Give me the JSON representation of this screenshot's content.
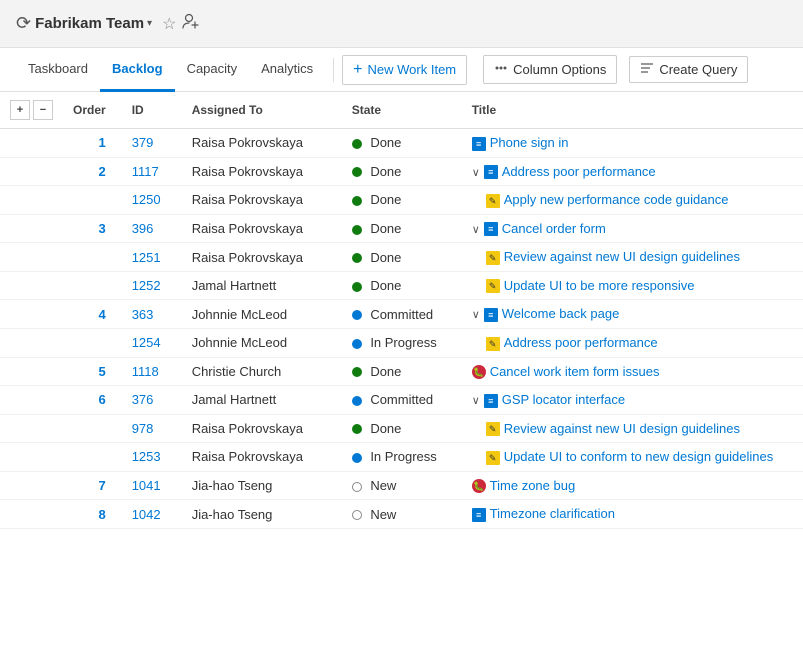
{
  "topbar": {
    "team_name": "Fabrikam Team",
    "team_icon": "🔄",
    "chevron": "▾",
    "star": "☆",
    "person": "👤"
  },
  "nav": {
    "tabs": [
      {
        "id": "taskboard",
        "label": "Taskboard",
        "active": false
      },
      {
        "id": "backlog",
        "label": "Backlog",
        "active": true
      },
      {
        "id": "capacity",
        "label": "Capacity",
        "active": false
      },
      {
        "id": "analytics",
        "label": "Analytics",
        "active": false
      }
    ]
  },
  "toolbar": {
    "new_work_item": "New Work Item",
    "column_options": "Column Options",
    "create_query": "Create Query",
    "new_icon": "+",
    "col_icon": "🖊",
    "query_icon": "≡"
  },
  "table": {
    "headers": [
      "",
      "Order",
      "ID",
      "Assigned To",
      "State",
      "Title"
    ],
    "rows": [
      {
        "order": "1",
        "id": "379",
        "assigned": "Raisa Pokrovskaya",
        "state": "Done",
        "state_type": "done",
        "title": "Phone sign in",
        "item_type": "user-story",
        "indent": 0,
        "collapsible": false
      },
      {
        "order": "2",
        "id": "1117",
        "assigned": "Raisa Pokrovskaya",
        "state": "Done",
        "state_type": "done",
        "title": "Address poor performance",
        "item_type": "user-story",
        "indent": 0,
        "collapsible": true
      },
      {
        "order": "",
        "id": "1250",
        "assigned": "Raisa Pokrovskaya",
        "state": "Done",
        "state_type": "done",
        "title": "Apply new performance code guidance",
        "item_type": "task",
        "indent": 1,
        "collapsible": false
      },
      {
        "order": "3",
        "id": "396",
        "assigned": "Raisa Pokrovskaya",
        "state": "Done",
        "state_type": "done",
        "title": "Cancel order form",
        "item_type": "user-story",
        "indent": 0,
        "collapsible": true
      },
      {
        "order": "",
        "id": "1251",
        "assigned": "Raisa Pokrovskaya",
        "state": "Done",
        "state_type": "done",
        "title": "Review against new UI design guidelines",
        "item_type": "task",
        "indent": 1,
        "collapsible": false
      },
      {
        "order": "",
        "id": "1252",
        "assigned": "Jamal Hartnett",
        "state": "Done",
        "state_type": "done",
        "title": "Update UI to be more responsive",
        "item_type": "task",
        "indent": 1,
        "collapsible": false
      },
      {
        "order": "4",
        "id": "363",
        "assigned": "Johnnie McLeod",
        "state": "Committed",
        "state_type": "committed",
        "title": "Welcome back page",
        "item_type": "user-story",
        "indent": 0,
        "collapsible": true
      },
      {
        "order": "",
        "id": "1254",
        "assigned": "Johnnie McLeod",
        "state": "In Progress",
        "state_type": "in-progress",
        "title": "Address poor performance",
        "item_type": "task",
        "indent": 1,
        "collapsible": false
      },
      {
        "order": "5",
        "id": "1118",
        "assigned": "Christie Church",
        "state": "Done",
        "state_type": "done",
        "title": "Cancel work item form issues",
        "item_type": "bug",
        "indent": 0,
        "collapsible": false
      },
      {
        "order": "6",
        "id": "376",
        "assigned": "Jamal Hartnett",
        "state": "Committed",
        "state_type": "committed",
        "title": "GSP locator interface",
        "item_type": "user-story",
        "indent": 0,
        "collapsible": true
      },
      {
        "order": "",
        "id": "978",
        "assigned": "Raisa Pokrovskaya",
        "state": "Done",
        "state_type": "done",
        "title": "Review against new UI design guidelines",
        "item_type": "task",
        "indent": 1,
        "collapsible": false
      },
      {
        "order": "",
        "id": "1253",
        "assigned": "Raisa Pokrovskaya",
        "state": "In Progress",
        "state_type": "in-progress",
        "title": "Update UI to conform to new design guidelines",
        "item_type": "task",
        "indent": 1,
        "collapsible": false
      },
      {
        "order": "7",
        "id": "1041",
        "assigned": "Jia-hao Tseng",
        "state": "New",
        "state_type": "new",
        "title": "Time zone bug",
        "item_type": "bug",
        "indent": 0,
        "collapsible": false
      },
      {
        "order": "8",
        "id": "1042",
        "assigned": "Jia-hao Tseng",
        "state": "New",
        "state_type": "new",
        "title": "Timezone clarification",
        "item_type": "user-story",
        "indent": 0,
        "collapsible": false
      }
    ]
  },
  "colors": {
    "accent": "#0078d4",
    "done": "#107c10",
    "committed": "#0078d4",
    "in_progress": "#0078d4",
    "new": "#888888"
  }
}
